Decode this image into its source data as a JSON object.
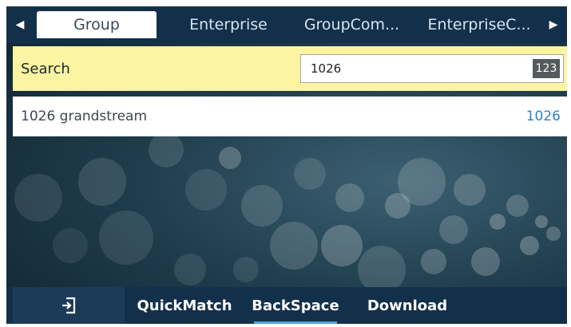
{
  "tabs": {
    "left_arrow_icon": "triangle-left-icon",
    "right_arrow_icon": "triangle-right-icon",
    "items": [
      {
        "label": "Group",
        "active": true
      },
      {
        "label": "Enterprise",
        "active": false
      },
      {
        "label": "GroupCom...",
        "active": false
      },
      {
        "label": "EnterpriseC...",
        "active": false
      }
    ]
  },
  "search": {
    "label": "Search",
    "value": "1026",
    "input_mode": "123"
  },
  "results": [
    {
      "name": "1026 grandstream",
      "number": "1026"
    }
  ],
  "softkeys": {
    "exit_icon": "exit-icon",
    "quickmatch": "QuickMatch",
    "backspace": "BackSpace",
    "download": "Download"
  },
  "colors": {
    "bar_background": "#13304a",
    "search_highlight": "#fbf4a0",
    "number_accent": "#2f7fd0"
  }
}
